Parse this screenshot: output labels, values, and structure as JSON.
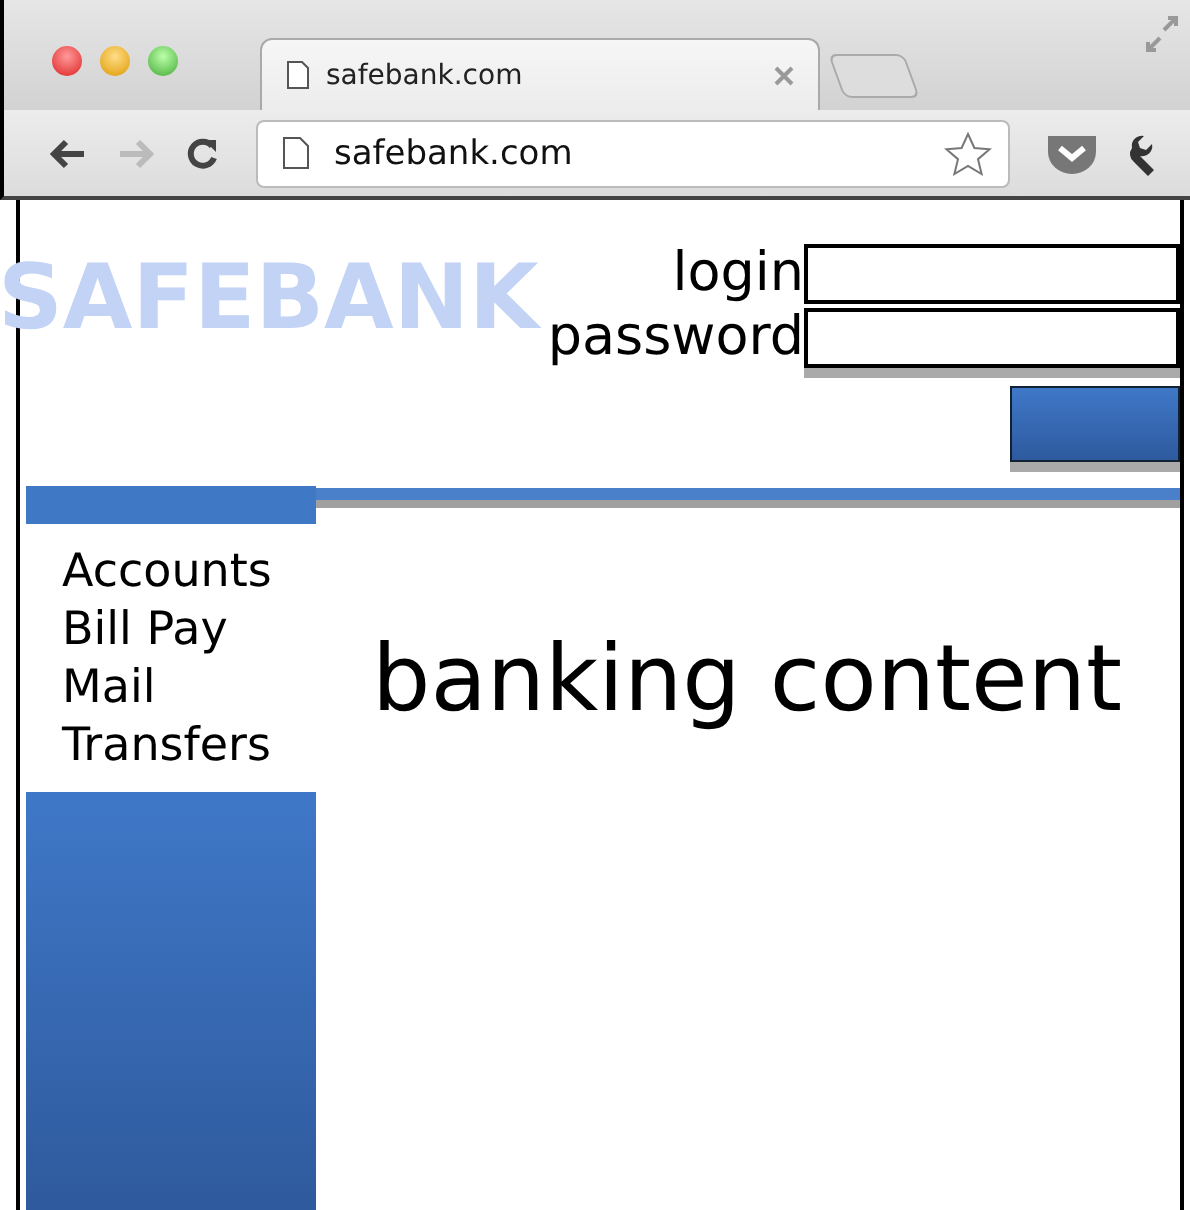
{
  "browser": {
    "tab_title": "safebank.com",
    "url": "safebank.com"
  },
  "header": {
    "logo": "SAFEBANK",
    "login_label": "login",
    "password_label": "password"
  },
  "nav": [
    "Accounts",
    "Bill Pay",
    "Mail",
    "Transfers"
  ],
  "content": "banking content"
}
